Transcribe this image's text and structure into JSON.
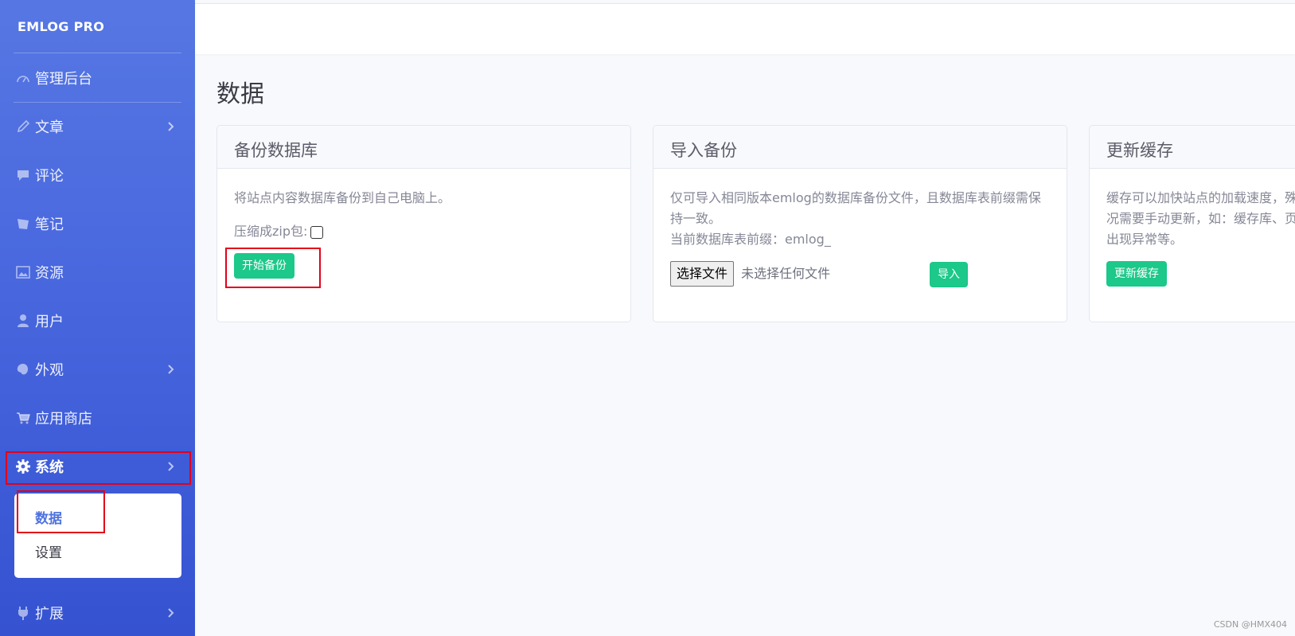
{
  "sidebar": {
    "brand": "EMLOG PRO",
    "items": [
      {
        "label": "管理后台"
      },
      {
        "label": "文章"
      },
      {
        "label": "评论"
      },
      {
        "label": "笔记"
      },
      {
        "label": "资源"
      },
      {
        "label": "用户"
      },
      {
        "label": "外观"
      },
      {
        "label": "应用商店"
      },
      {
        "label": "系统"
      },
      {
        "label": "扩展"
      }
    ],
    "submenu": [
      {
        "label": "数据"
      },
      {
        "label": "设置"
      }
    ]
  },
  "main": {
    "title": "数据",
    "cards": {
      "backup": {
        "title": "备份数据库",
        "desc": "将站点内容数据库备份到自己电脑上。",
        "zip_label": "压缩成zip包:",
        "button": "开始备份"
      },
      "import": {
        "title": "导入备份",
        "desc1": "仅可导入相同版本emlog的数据库备份文件，且数据库表前缀需保持一致。",
        "desc2": "当前数据库表前缀：emlog_",
        "file_button": "选择文件",
        "file_status": "未选择任何文件",
        "button": "导入"
      },
      "cache": {
        "title": "更新缓存",
        "desc": "缓存可以加快站点的加载速度，殊情况需要手动更新，如：缓存库、页面出现异常等。",
        "button": "更新缓存"
      }
    }
  },
  "watermark": "CSDN @HMX404",
  "colors": {
    "accent": "#4e73df",
    "success": "#1cc88a",
    "highlight": "#e3001b"
  }
}
